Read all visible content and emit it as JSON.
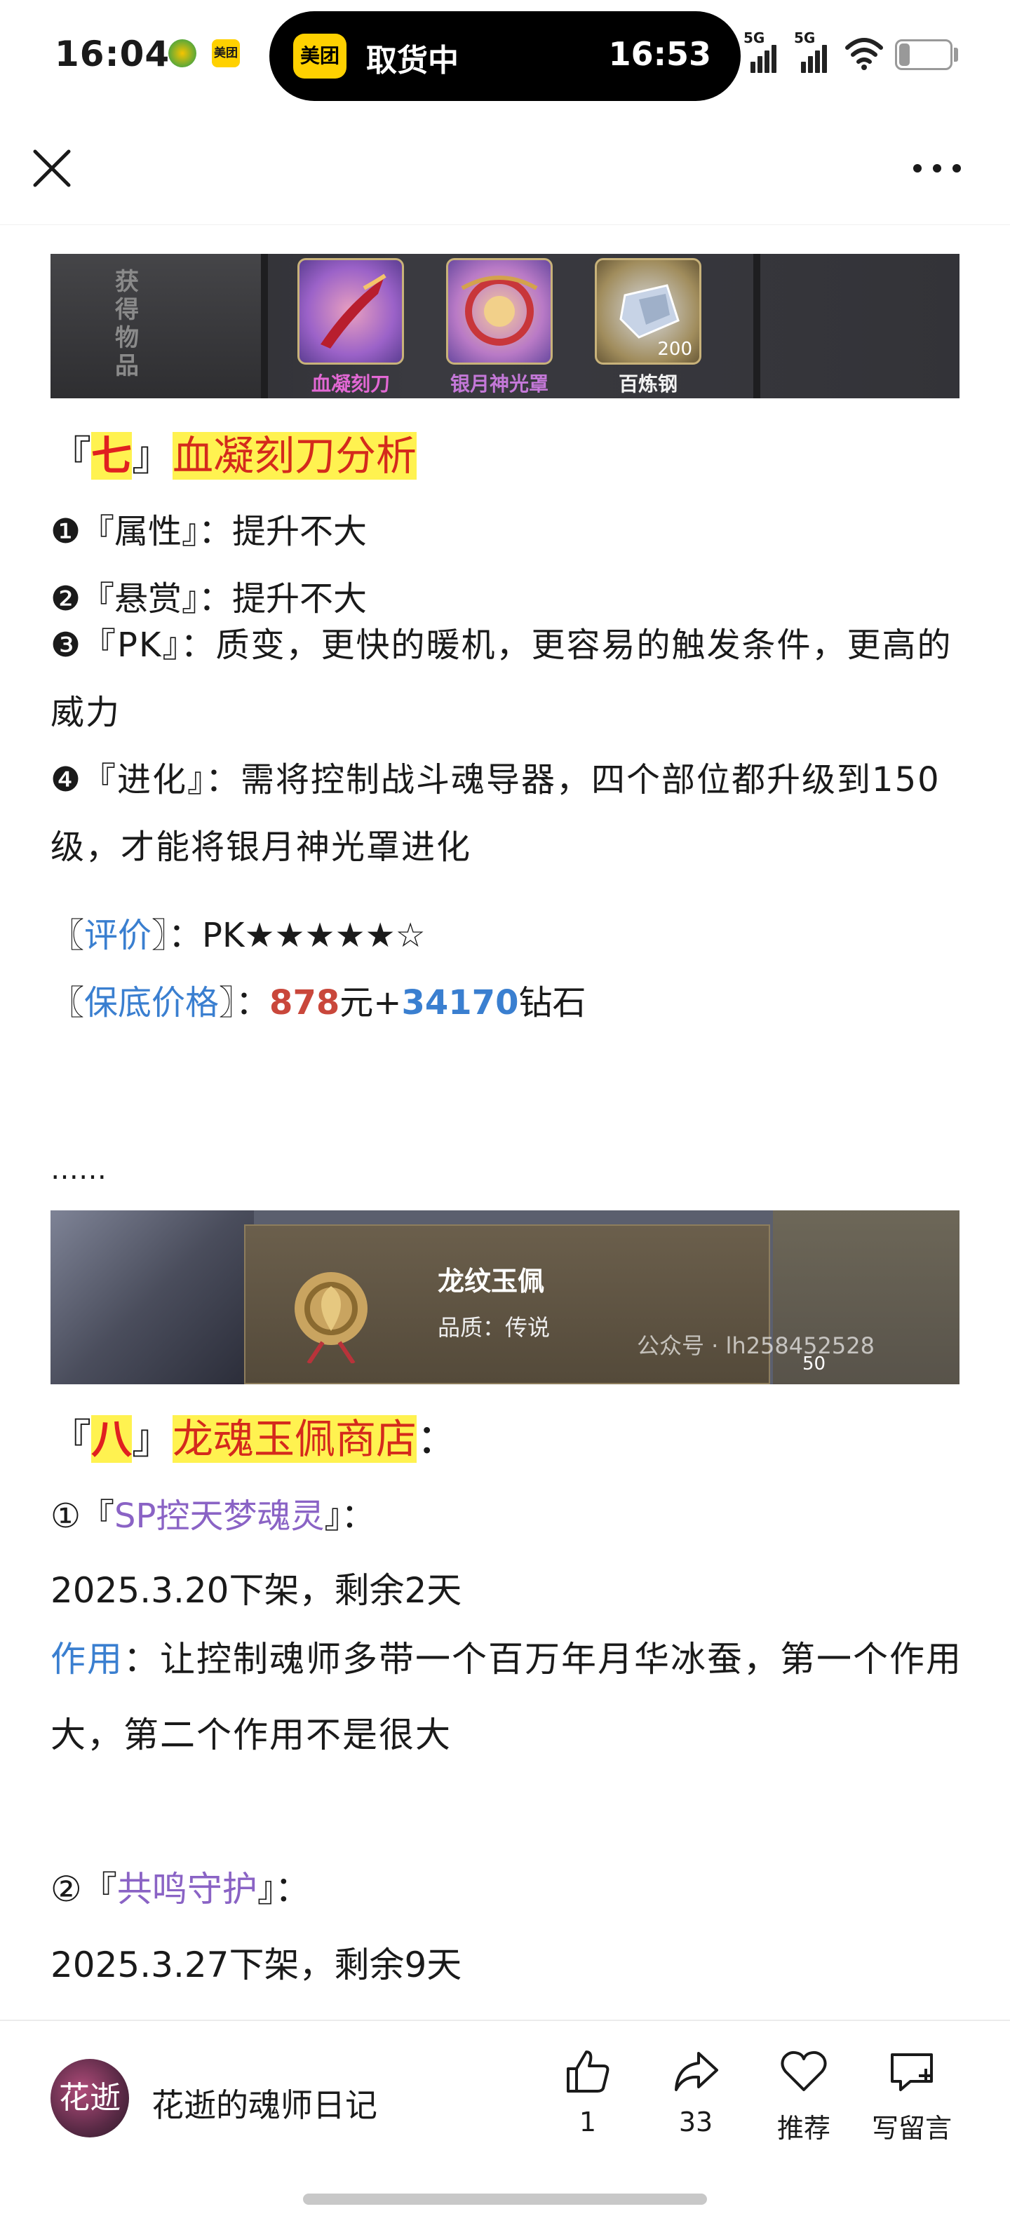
{
  "status_bar": {
    "time": "16:04",
    "meituan_label": "美团",
    "pill_text": "取货中",
    "pill_time": "16:53",
    "signal1": "5G",
    "signal2": "5G",
    "battery": "5"
  },
  "nav": {
    "close_icon": "close-icon",
    "more_icon": "more-icon"
  },
  "article": {
    "image1": {
      "side_label": "获得物品",
      "items": [
        {
          "name": "血凝刻刀",
          "count": ""
        },
        {
          "name": "银月神光罩",
          "count": ""
        },
        {
          "name": "百炼钢",
          "count": "200"
        }
      ]
    },
    "section7": {
      "bracket_open": "『",
      "num": "七",
      "bracket_close": "』",
      "title": "血凝刻刀分析",
      "p1": "❶『属性』：提升不大",
      "p2": "❷『悬赏』：提升不大",
      "p3": "❸『PK』：质变，更快的暖机，更容易的触发条件，更高的威力",
      "p4": "❹『进化』：需将控制战斗魂导器，四个部位都升级到150级，才能将银月神光罩进化",
      "rating_open": "〖",
      "rating_label": "评价",
      "rating_close": "〗：",
      "rating_value": "PK★★★★★☆",
      "price_open": "〖",
      "price_label": "保底价格",
      "price_close": "〗：",
      "price_yuan": "878",
      "price_yuan_unit": "元+",
      "price_diamond": "34170",
      "price_diamond_unit": "钻石"
    },
    "ellipsis": "……",
    "image2": {
      "item_name": "龙纹玉佩",
      "quality": "品质：传说",
      "watermark": "公众号 · lh258452528",
      "count": "50"
    },
    "section8": {
      "bracket_open": "『",
      "num": "八",
      "bracket_close": "』",
      "title": "龙魂玉佩商店",
      "colon": "：",
      "i1_prefix": "①『",
      "i1_name": "SP控天梦魂灵",
      "i1_suffix": "』：",
      "i1_date": "2025.3.20下架，剩余2天",
      "effect_label": "作用",
      "effect_text": "：让控制魂师多带一个百万年月华冰蚕，第一个作用大，第二个作用不是很大",
      "i2_prefix": "②『",
      "i2_name": "共鸣守护",
      "i2_suffix": "』：",
      "i2_date": "2025.3.27下架，剩余9天"
    }
  },
  "bottom_bar": {
    "avatar_text": "花逝",
    "account_name": "花逝的魂师日记",
    "like_count": "1",
    "share_count": "33",
    "recommend_label": "推荐",
    "comment_label": "写留言"
  }
}
